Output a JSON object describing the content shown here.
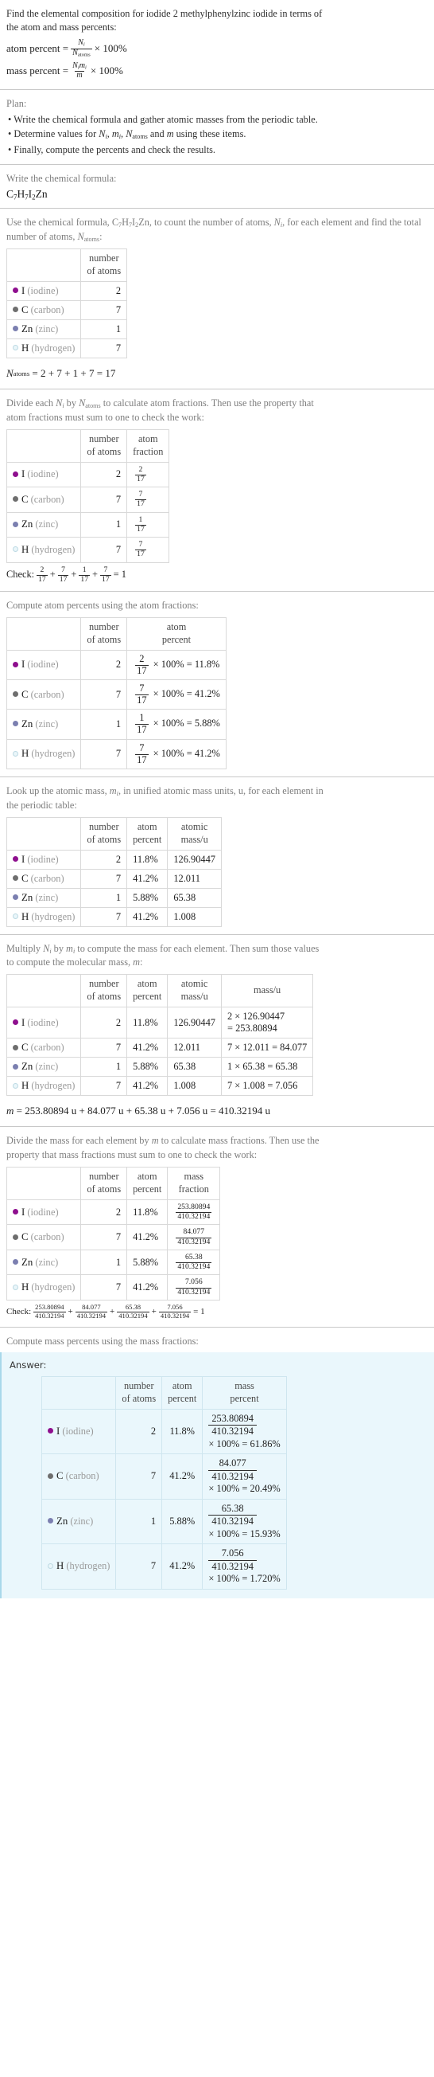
{
  "question": {
    "line1": "Find the elemental composition for iodide 2 methylphenylzinc iodide in terms of",
    "line2": "the atom and mass percents:",
    "atom_percent_label": "atom percent =",
    "mass_percent_label": "mass percent =",
    "times100": "× 100%"
  },
  "plan": {
    "heading": "Plan:",
    "bullets": [
      "• Write the chemical formula and gather atomic masses from the periodic table.",
      "• Finally, compute the percents and check the results."
    ],
    "bullet2_prefix": "• Determine values for ",
    "bullet2_suffix": " using these items."
  },
  "formula_section": {
    "heading": "Write the chemical formula:",
    "formula_plain": "C7H7I2Zn",
    "parts": [
      {
        "sym": "C",
        "sub": "7"
      },
      {
        "sym": "H",
        "sub": "7"
      },
      {
        "sym": "I",
        "sub": "2"
      },
      {
        "sym": "Zn",
        "sub": ""
      }
    ]
  },
  "elements": [
    {
      "symbol": "I",
      "name": "(iodine)",
      "color": "#8e0f8e",
      "filled": true,
      "count": "2",
      "num": "2",
      "den": "17",
      "atom_percent": "11.8%",
      "atomic_mass": "126.90447",
      "mass_expr": "2 × 126.90447",
      "mass_expr2": "= 253.80894",
      "mass_value": "253.80894",
      "mass_percent": "61.86%"
    },
    {
      "symbol": "C",
      "name": "(carbon)",
      "color": "#6e6e6e",
      "filled": true,
      "count": "7",
      "num": "7",
      "den": "17",
      "atom_percent": "41.2%",
      "atomic_mass": "12.011",
      "mass_expr": "7 × 12.011 = 84.077",
      "mass_expr2": "",
      "mass_value": "84.077",
      "mass_percent": "20.49%"
    },
    {
      "symbol": "Zn",
      "name": "(zinc)",
      "color": "#7b7fb0",
      "filled": true,
      "count": "1",
      "num": "1",
      "den": "17",
      "atom_percent": "5.88%",
      "atomic_mass": "65.38",
      "mass_expr": "1 × 65.38 = 65.38",
      "mass_expr2": "",
      "mass_value": "65.38",
      "mass_percent": "15.93%"
    },
    {
      "symbol": "H",
      "name": "(hydrogen)",
      "color": "#eaf6fa",
      "filled": false,
      "count": "7",
      "num": "7",
      "den": "17",
      "atom_percent": "41.2%",
      "atomic_mass": "1.008",
      "mass_expr": "7 × 1.008 = 7.056",
      "mass_expr2": "",
      "mass_value": "7.056",
      "mass_percent": "1.720%"
    }
  ],
  "count_section": {
    "text_a": "Use the chemical formula, ",
    "text_b": ", to count the number of atoms, ",
    "text_c": ", for each",
    "text_d": "element and find the total number of atoms, ",
    "text_e": ":",
    "col_blank": "",
    "col_number": "number\nof atoms",
    "col_number_l1": "number",
    "col_number_l2": "of atoms",
    "total_expr": "= 2 + 7 + 1 + 7 = 17"
  },
  "fraction_section": {
    "line1_a": "Divide each ",
    "line1_b": " by ",
    "line1_c": " to calculate atom fractions. Then use the property that",
    "line2": "atom fractions must sum to one to check the work:",
    "col_atom_l1": "atom",
    "col_atom_l2": "fraction",
    "check_label": "Check:",
    "check_result": "= 1"
  },
  "atompct_section": {
    "heading": "Compute atom percents using the atom fractions:",
    "col_atom_l1": "atom",
    "col_atom_l2": "percent",
    "times": "× 100% ="
  },
  "atomicmass_section": {
    "line1_a": "Look up the atomic mass, ",
    "line1_b": ", in unified atomic mass units, u, for each element in",
    "line2": "the periodic table:",
    "col_mass_l1": "atomic",
    "col_mass_l2": "mass/u"
  },
  "molmass_section": {
    "line1_a": "Multiply ",
    "line1_b": " by ",
    "line1_c": " to compute the mass for each element. Then sum those values",
    "line2_a": "to compute the molecular mass, ",
    "line2_b": ":",
    "col_mass": "mass/u",
    "sum_expr": "= 253.80894 u + 84.077 u + 65.38 u + 7.056 u = 410.32194 u",
    "total_mass": "410.32194"
  },
  "massfrac_section": {
    "line1_a": "Divide the mass for each element by ",
    "line1_b": " to calculate mass fractions. Then use the",
    "line2": "property that mass fractions must sum to one to check the work:",
    "col_mass_l1": "mass",
    "col_mass_l2": "fraction",
    "check_label": "Check:",
    "check_result": "= 1"
  },
  "answer_section": {
    "heading": "Compute mass percents using the mass fractions:",
    "answer_label": "Answer:",
    "col_mass_l1": "mass",
    "col_mass_l2": "percent",
    "times": "× 100% ="
  },
  "colors": {
    "answer_bg": "#eaf7fc",
    "answer_border": "#a8d8ea",
    "rule": "#c8c8c8",
    "table_border": "#d9d9d9"
  }
}
